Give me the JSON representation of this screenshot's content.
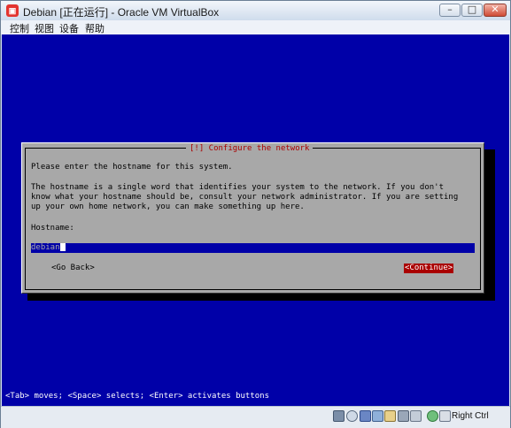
{
  "window": {
    "title": "Debian [正在运行] - Oracle VM VirtualBox"
  },
  "menubar": {
    "items": [
      "控制",
      "视图",
      "设备",
      "帮助"
    ]
  },
  "installer": {
    "dialog_title": "[!] Configure the network",
    "prompt": "Please enter the hostname for this system.",
    "description": [
      "The hostname is a single word that identifies your system to the network. If you don't",
      "know what your hostname should be, consult your network administrator. If you are setting",
      "up your own home network, you can make something up here."
    ],
    "field_label": "Hostname:",
    "field_value": "debian",
    "go_back_label": "<Go Back>",
    "continue_label": "<Continue>",
    "help_line": "<Tab> moves; <Space> selects; <Enter> activates buttons"
  },
  "statusbar": {
    "icons": [
      "hard-disk-icon",
      "optical-drive-icon",
      "usb-icon",
      "shared-folders-icon",
      "network-icon",
      "display-icon",
      "recording-icon",
      "mouse-integration-icon",
      "cpu-icon"
    ],
    "host_key": "Right Ctrl"
  },
  "colors": {
    "screen": "#0000a8",
    "dialog": "#a8a8a8",
    "title_text": "#aa0000",
    "selected_button": "#aa0000"
  }
}
